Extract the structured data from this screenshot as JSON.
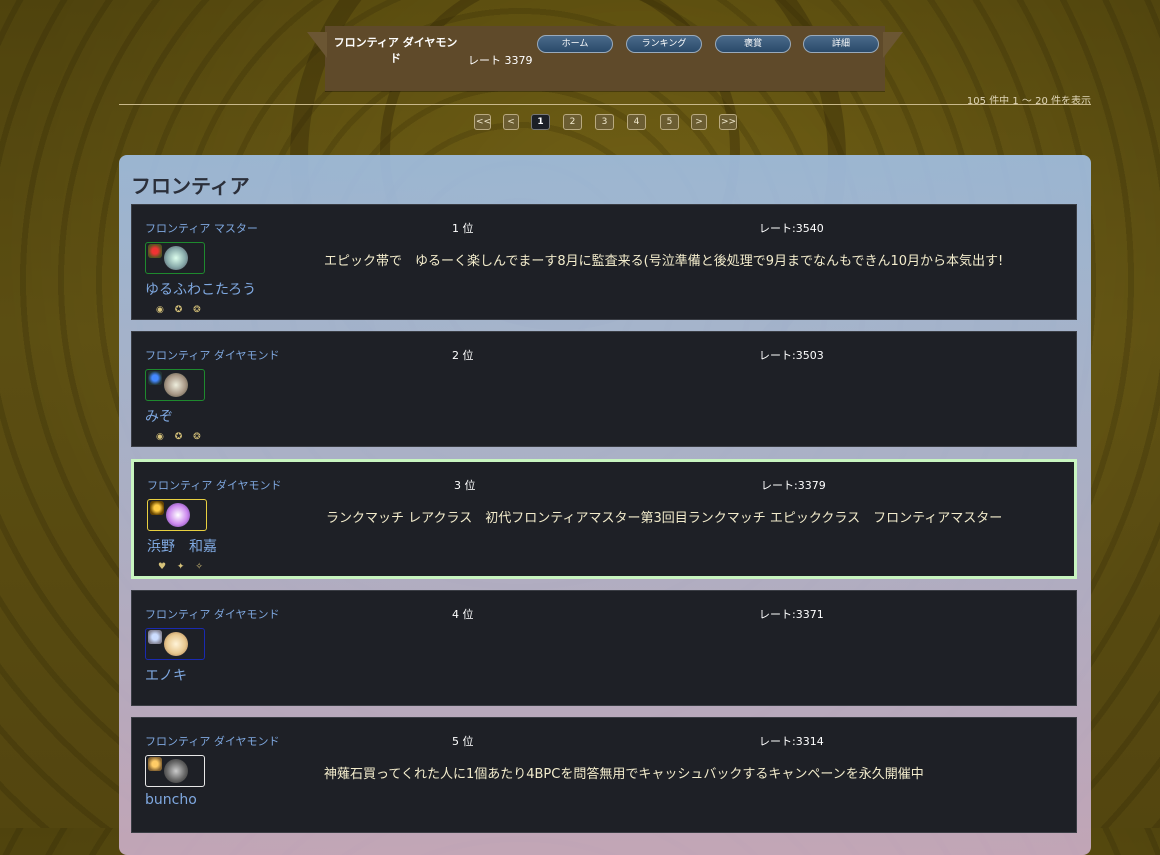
{
  "topbar": {
    "player_name": "フロンティア ダイヤモンド",
    "rate": "レート 3379",
    "nav": [
      "ホーム",
      "ランキング",
      "褒賞",
      "詳細"
    ]
  },
  "result_count": "105 件中 1 〜 20 件を表示",
  "pagination": [
    "<<",
    "<",
    "1",
    "2",
    "3",
    "4",
    "5",
    ">",
    ">>"
  ],
  "pagination_active": "1",
  "section_title": "フロンティア",
  "entries": [
    {
      "rank_label": "フロンティア マスター",
      "position": "1 位",
      "rate": "レート:3540",
      "name": "ゆるふわこたろう",
      "comment": "エピック帯で　ゆるーく楽しんでまーす8月に監査来る(号泣準備と後処理で9月までなんもできん10月から本気出す!",
      "badges": "◉ ✪ ❂",
      "avatar_border": "#1e8a2e"
    },
    {
      "rank_label": "フロンティア ダイヤモンド",
      "position": "2 位",
      "rate": "レート:3503",
      "name": "みぞ",
      "comment": "",
      "badges": "◉ ✪ ❂",
      "avatar_border": "#1e8a2e"
    },
    {
      "rank_label": "フロンティア ダイヤモンド",
      "position": "3 位",
      "rate": "レート:3379",
      "name": "浜野　和嘉",
      "comment": "ランクマッチ レアクラス　初代フロンティアマスター第3回目ランクマッチ エピッククラス　フロンティアマスター",
      "badges": "♥ ✦ ✧",
      "avatar_border": "#e8d040"
    },
    {
      "rank_label": "フロンティア ダイヤモンド",
      "position": "4 位",
      "rate": "レート:3371",
      "name": "エノキ",
      "comment": "",
      "badges": "",
      "avatar_border": "#1a2ab0"
    },
    {
      "rank_label": "フロンティア ダイヤモンド",
      "position": "5 位",
      "rate": "レート:3314",
      "name": "buncho",
      "comment": "神薙石買ってくれた人に1個あたり4BPCを問答無用でキャッシュバックするキャンペーンを永久開催中",
      "badges": "",
      "avatar_border": "#e8e8e8"
    }
  ]
}
